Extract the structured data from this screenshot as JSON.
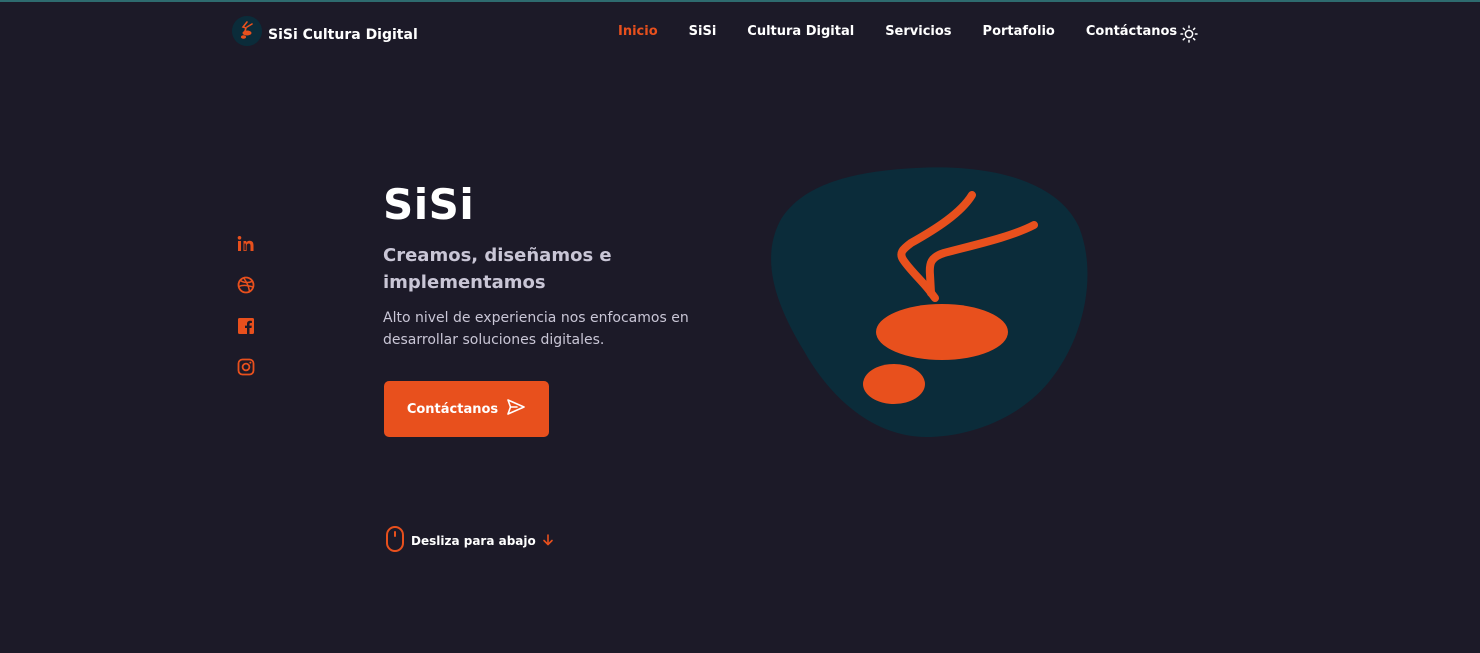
{
  "brand": {
    "name": "SiSi Cultura Digital",
    "logo_icon": "sisi-logo-icon",
    "accent_color": "#e8501d",
    "background_color": "#1c1a28",
    "blob_color": "#0b2c3a"
  },
  "nav": {
    "items": [
      {
        "label": "Inicio",
        "active": true
      },
      {
        "label": "SiSi",
        "active": false
      },
      {
        "label": "Cultura Digital",
        "active": false
      },
      {
        "label": "Servicios",
        "active": false
      },
      {
        "label": "Portafolio",
        "active": false
      },
      {
        "label": "Contáctanos",
        "active": false
      }
    ],
    "theme_toggle_icon": "sun-icon"
  },
  "social": {
    "icons": [
      "linkedin-icon",
      "dribbble-icon",
      "facebook-icon",
      "instagram-icon"
    ]
  },
  "hero": {
    "title": "SiSi",
    "subtitle": "Creamos, diseñamos e implementamos",
    "description": "Alto nivel de experiencia nos enfocamos en desarrollar soluciones digitales.",
    "cta_label": "Contáctanos",
    "cta_icon": "send-icon",
    "image_icon": "sisi-mascot-icon"
  },
  "scroll": {
    "label": "Desliza para abajo",
    "mouse_icon": "mouse-icon",
    "arrow_icon": "arrow-down-icon"
  }
}
